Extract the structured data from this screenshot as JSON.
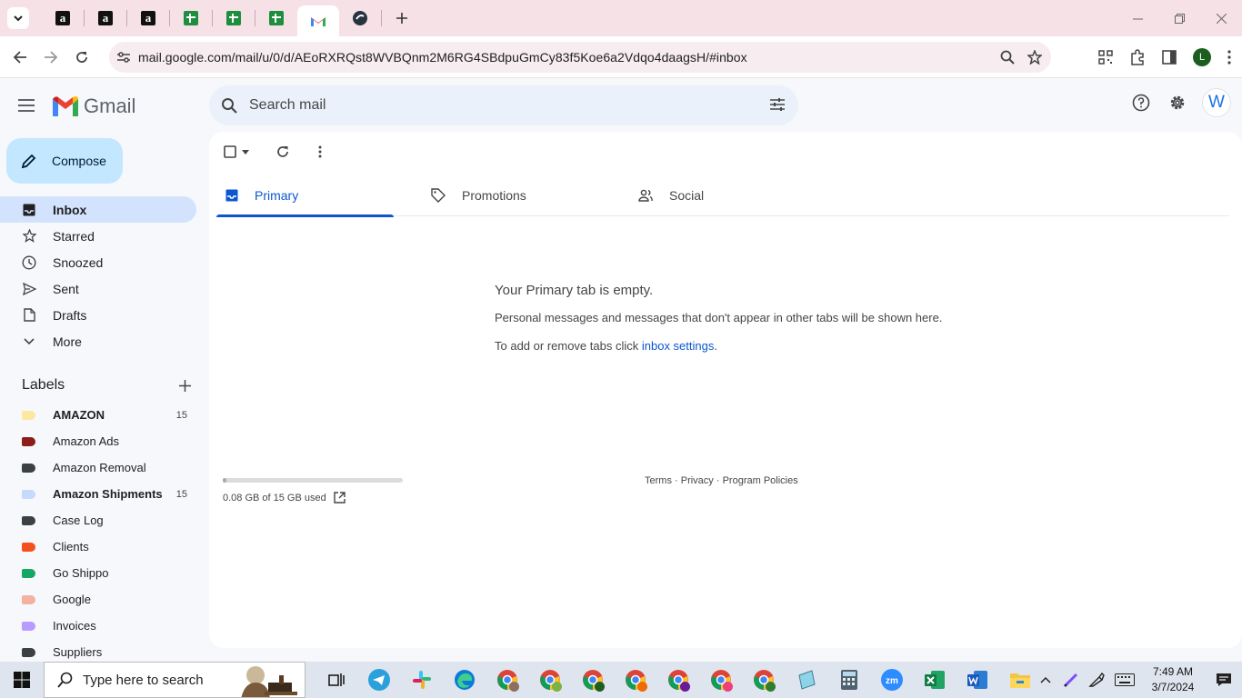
{
  "browser": {
    "tabs": [
      {
        "icon": "amazon-icon",
        "glyph": "a"
      },
      {
        "icon": "amazon-icon",
        "glyph": "a"
      },
      {
        "icon": "amazon-icon",
        "glyph": "a"
      },
      {
        "icon": "sheets-icon",
        "glyph": ""
      },
      {
        "icon": "sheets-icon",
        "glyph": ""
      },
      {
        "icon": "sheets-icon",
        "glyph": ""
      },
      {
        "icon": "gmail-icon",
        "glyph": "",
        "active": true
      },
      {
        "icon": "globe-icon",
        "glyph": ""
      }
    ],
    "url": "mail.google.com/mail/u/0/d/AEoRXRQst8WVBQnm2M6RG4SBdpuGmCy83f5Koe6a2Vdqo4daagsH/#inbox",
    "profile_initial": "L"
  },
  "gmail": {
    "app_name": "Gmail",
    "search_placeholder": "Search mail",
    "account_initial": "W",
    "compose_label": "Compose",
    "nav": [
      {
        "label": "Inbox",
        "icon": "inbox-icon",
        "active": true
      },
      {
        "label": "Starred",
        "icon": "star-icon"
      },
      {
        "label": "Snoozed",
        "icon": "clock-icon"
      },
      {
        "label": "Sent",
        "icon": "send-icon"
      },
      {
        "label": "Drafts",
        "icon": "draft-icon"
      },
      {
        "label": "More",
        "icon": "chevron-down-icon"
      }
    ],
    "labels_heading": "Labels",
    "labels": [
      {
        "name": "AMAZON",
        "color": "#fce8a0",
        "count": "15",
        "bold": true
      },
      {
        "name": "Amazon Ads",
        "color": "#8c1d18",
        "count": ""
      },
      {
        "name": "Amazon Removal",
        "color": "#3c4043",
        "count": ""
      },
      {
        "name": "Amazon Shipments",
        "color": "#c6dafc",
        "count": "15",
        "bold": true
      },
      {
        "name": "Case Log",
        "color": "#3c4043",
        "count": ""
      },
      {
        "name": "Clients",
        "color": "#f4511e",
        "count": ""
      },
      {
        "name": "Go Shippo",
        "color": "#16a765",
        "count": ""
      },
      {
        "name": "Google",
        "color": "#f4b0a0",
        "count": ""
      },
      {
        "name": "Invoices",
        "color": "#b99aff",
        "count": ""
      },
      {
        "name": "Suppliers",
        "color": "#3c4043",
        "count": ""
      }
    ],
    "category_tabs": [
      {
        "label": "Primary",
        "icon": "inbox-tab-icon",
        "active": true
      },
      {
        "label": "Promotions",
        "icon": "tag-icon"
      },
      {
        "label": "Social",
        "icon": "people-icon"
      }
    ],
    "empty_state": {
      "title": "Your Primary tab is empty.",
      "message": "Personal messages and messages that don't appear in other tabs will be shown here.",
      "settings_prefix": "To add or remove tabs click ",
      "settings_link": "inbox settings",
      "settings_suffix": "."
    },
    "storage": {
      "text": "0.08 GB of 15 GB used",
      "fraction": 0.005
    },
    "footer": {
      "terms": "Terms",
      "privacy": "Privacy",
      "policies": "Program Policies",
      "separator": " · "
    }
  },
  "taskbar": {
    "search_placeholder": "Type here to search",
    "time": "7:49 AM",
    "date": "3/7/2024"
  }
}
